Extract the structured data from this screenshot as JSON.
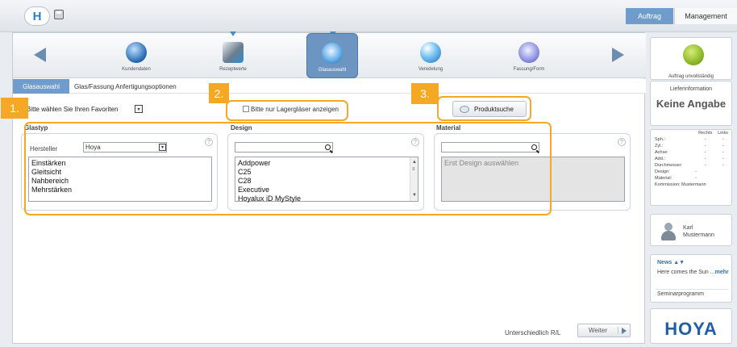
{
  "topbar": {
    "logo_letter": "H",
    "tabs": {
      "auftrag": "Auftrag",
      "management": "Management"
    }
  },
  "stepper": {
    "steps": [
      {
        "label": "Kundendaten",
        "icon": "user-globe-icon"
      },
      {
        "label": "Rezeptwerte",
        "icon": "prescription-document-icon"
      },
      {
        "label": "Glasauswahl",
        "icon": "lens-icon",
        "active": true
      },
      {
        "label": "Veredelung",
        "icon": "lens-coating-icon"
      },
      {
        "label": "Fassung/Form",
        "icon": "frame-shape-icon"
      }
    ]
  },
  "tabs": {
    "glasauswahl": "Glasauswahl",
    "options": "Glas/Fassung Anfertigungsoptionen"
  },
  "favorites": {
    "label": "Bitte wählen Sie Ihren Favoriten"
  },
  "lager": {
    "label": "Bitte nur Lagergläser anzeigen",
    "checked": false
  },
  "produktsuche": {
    "label": "Produktsuche"
  },
  "badges": {
    "one": "1.",
    "two": "2.",
    "three": "3."
  },
  "glastyp": {
    "title": "Glastyp",
    "hersteller_label": "Hersteller",
    "hersteller_value": "Hoya",
    "items": [
      "Einstärken",
      "Gleitsicht",
      "Nahbereich",
      "Mehrstärken"
    ]
  },
  "design": {
    "title": "Design",
    "search_value": "",
    "items": [
      "Addpower",
      "C25",
      "C28",
      "Executive",
      "Hoyalux iD MyStyle"
    ]
  },
  "material": {
    "title": "Material",
    "search_value": "",
    "placeholder_text": "Erst Design auswählen"
  },
  "help_glyph": "?",
  "footer": {
    "status": "Unterschiedlich R/L",
    "weiter": "Weiter"
  },
  "sidebar": {
    "status_label": "Auftrag unvollständig",
    "lieferinfo_title": "Lieferinformation",
    "lieferinfo_value": "Keine Angabe",
    "rx_table": {
      "col_rechts": "Rechts",
      "col_links": "Links",
      "rows": [
        {
          "label": "Sph.:",
          "r": "-",
          "l": "-"
        },
        {
          "label": "Zyl.:",
          "r": "-",
          "l": "-"
        },
        {
          "label": "Achse:",
          "r": "-",
          "l": "-"
        },
        {
          "label": "Add.:",
          "r": "-",
          "l": "-"
        },
        {
          "label": "Durchmesser:",
          "r": "-",
          "l": "-"
        },
        {
          "label": "Design:",
          "r": "-",
          "l": ""
        },
        {
          "label": "Material:",
          "r": "-",
          "l": ""
        }
      ],
      "kommission": "Kommission: Mustermann"
    },
    "user": {
      "first": "Karl",
      "last": "Mustermann"
    },
    "news": {
      "title": "News ▲▼",
      "text": "Here comes the Sun ...",
      "more": "mehr",
      "seminar": "Seminarprogramm"
    },
    "brand": "HOYA"
  },
  "colors": {
    "accent_blue": "#6f9ccc",
    "highlight_orange": "#f4a823",
    "brand_blue": "#1f5fa8"
  }
}
